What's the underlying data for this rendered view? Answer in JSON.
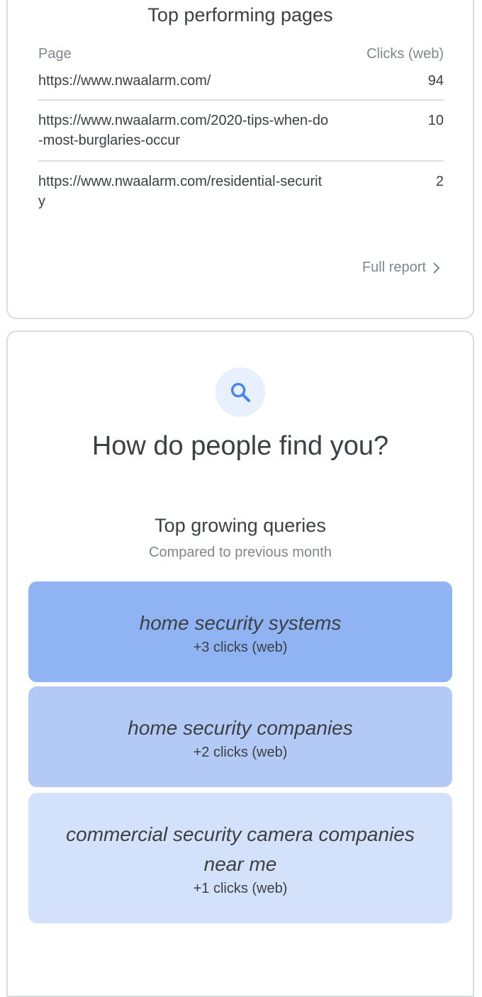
{
  "top_pages": {
    "title": "Top performing pages",
    "columns": {
      "page": "Page",
      "clicks": "Clicks (web)"
    },
    "rows": [
      {
        "url": "https://www.nwaalarm.com/",
        "clicks": "94"
      },
      {
        "url": "https://www.nwaalarm.com/2020-tips-when-do-most-burglaries-occur",
        "clicks": "10"
      },
      {
        "url": "https://www.nwaalarm.com/residential-security",
        "clicks": "2"
      }
    ],
    "full_report_label": "Full report"
  },
  "find_you": {
    "icon": "search-icon",
    "title": "How do people find you?",
    "queries_title": "Top growing queries",
    "queries_subtitle": "Compared to previous month",
    "queries": [
      {
        "text": "home security systems",
        "clicks": "+3 clicks (web)",
        "color": "#8fb3f3"
      },
      {
        "text": "home security companies",
        "clicks": "+2 clicks (web)",
        "color": "#b3caf6"
      },
      {
        "text": "commercial security camera companies near me",
        "clicks": "+1 clicks (web)",
        "color": "#d4e1fa"
      }
    ]
  },
  "colors": {
    "accent": "#4285f4",
    "text_primary": "#3c4043",
    "text_secondary": "#80868b",
    "border": "#dadce0"
  }
}
